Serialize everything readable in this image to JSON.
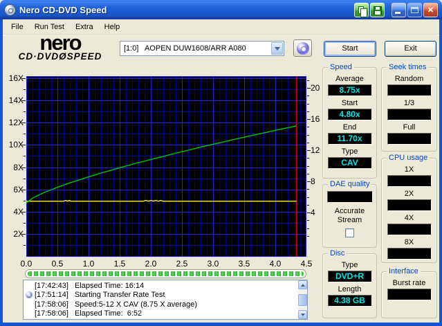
{
  "window": {
    "title": "Nero CD-DVD Speed"
  },
  "titlebar_buttons": {
    "copy": "copy",
    "save": "save",
    "minimize": "minimize",
    "maximize": "maximize",
    "close": "close"
  },
  "menu": {
    "items": [
      "File",
      "Run Test",
      "Extra",
      "Help"
    ]
  },
  "logo": {
    "line1": "nero",
    "line2": "CD·DVDØSPEED"
  },
  "toolbar": {
    "drive_value": "[1:0]   AOPEN DUW1608/ARR A080",
    "start_label": "Start",
    "exit_label": "Exit"
  },
  "chart_data": {
    "type": "line",
    "title": "",
    "xlabel": "",
    "ylabel": "",
    "x_axis": {
      "min": 0,
      "max": 4.5,
      "tick_step": 0.5,
      "tick_labels": [
        "0.0",
        "0.5",
        "1.0",
        "1.5",
        "2.0",
        "2.5",
        "3.0",
        "3.5",
        "4.0",
        "4.5"
      ]
    },
    "y_axis_left": {
      "min": 0,
      "max": 16.15,
      "tick_values": [
        16,
        14,
        12,
        10,
        8,
        6,
        4,
        2
      ],
      "tick_labels": [
        "16X",
        "14X",
        "12X",
        "10X",
        "8X",
        "6X",
        "4X",
        "2X"
      ]
    },
    "y_axis_right": {
      "tick_values": [
        20,
        16,
        12,
        8,
        4
      ],
      "tick_labels": [
        "20",
        "16",
        "12",
        "8",
        "4"
      ]
    },
    "grid": {
      "bg": "#000000",
      "major_color": "#2222DD",
      "minor_color": "#000090"
    },
    "series": [
      {
        "name": "requested-speed",
        "color": "#FFFF00",
        "points": [
          [
            0,
            4.95
          ],
          [
            0.6,
            4.95
          ],
          [
            0.63,
            5.02
          ],
          [
            0.66,
            4.95
          ],
          [
            0.69,
            5.02
          ],
          [
            0.72,
            4.95
          ],
          [
            1.88,
            4.95
          ],
          [
            1.92,
            5.02
          ],
          [
            1.96,
            4.95
          ],
          [
            2.0,
            5.02
          ],
          [
            2.04,
            4.95
          ],
          [
            2.08,
            5.02
          ],
          [
            2.12,
            4.95
          ],
          [
            2.16,
            5.02
          ],
          [
            2.2,
            4.95
          ],
          [
            4.34,
            4.95
          ]
        ]
      },
      {
        "name": "transfer-rate",
        "color": "#00C400",
        "points": [
          [
            0,
            4.8
          ],
          [
            0.1,
            5.22
          ],
          [
            0.2,
            5.51
          ],
          [
            0.3,
            5.76
          ],
          [
            0.4,
            5.98
          ],
          [
            0.5,
            6.19
          ],
          [
            0.6,
            6.4
          ],
          [
            0.7,
            6.59
          ],
          [
            0.8,
            6.77
          ],
          [
            0.9,
            6.95
          ],
          [
            1.0,
            7.13
          ],
          [
            1.2,
            7.47
          ],
          [
            1.4,
            7.79
          ],
          [
            1.6,
            8.1
          ],
          [
            1.8,
            8.4
          ],
          [
            2.0,
            8.69
          ],
          [
            2.2,
            8.97
          ],
          [
            2.4,
            9.25
          ],
          [
            2.6,
            9.52
          ],
          [
            2.8,
            9.79
          ],
          [
            3.0,
            10.05
          ],
          [
            3.2,
            10.31
          ],
          [
            3.4,
            10.56
          ],
          [
            3.6,
            10.81
          ],
          [
            3.8,
            11.05
          ],
          [
            4.0,
            11.3
          ],
          [
            4.2,
            11.53
          ],
          [
            4.34,
            11.7
          ]
        ]
      }
    ],
    "markers": [
      {
        "type": "vline",
        "x": 4.34,
        "color": "#D40000"
      }
    ]
  },
  "panels": {
    "speed": {
      "title": "Speed",
      "fields": [
        {
          "label": "Average",
          "value": "8.75x"
        },
        {
          "label": "Start",
          "value": "4.80x"
        },
        {
          "label": "End",
          "value": "11.70x"
        },
        {
          "label": "Type",
          "value": "CAV"
        }
      ]
    },
    "seek_times": {
      "title": "Seek times",
      "fields": [
        {
          "label": "Random",
          "value": ""
        },
        {
          "label": "1/3",
          "value": ""
        },
        {
          "label": "Full",
          "value": ""
        }
      ]
    },
    "dae": {
      "title": "DAE quality",
      "value": "",
      "checkbox_label": "Accurate Stream",
      "checked": false
    },
    "cpu": {
      "title": "CPU usage",
      "fields": [
        {
          "label": "1X",
          "value": ""
        },
        {
          "label": "2X",
          "value": ""
        },
        {
          "label": "4X",
          "value": ""
        },
        {
          "label": "8X",
          "value": ""
        }
      ]
    },
    "disc": {
      "title": "Disc",
      "fields": [
        {
          "label": "Type",
          "value": "DVD+R"
        },
        {
          "label": "Length",
          "value": "4.38 GB"
        }
      ]
    },
    "interface": {
      "title": "Interface",
      "fields": [
        {
          "label": "Burst rate",
          "value": ""
        }
      ]
    }
  },
  "log": {
    "lines": [
      {
        "icon": false,
        "time": "[17:42:43]",
        "text": "Elapsed Time: 16:14"
      },
      {
        "icon": true,
        "time": "[17:51:14]",
        "text": "Starting Transfer Rate Test"
      },
      {
        "icon": false,
        "time": "[17:58:06]",
        "text": "Speed:5-12 X CAV (8.75 X average)"
      },
      {
        "icon": false,
        "time": "[17:58:06]",
        "text": "Elapsed Time:  6:52"
      }
    ]
  },
  "colors": {
    "window_bg": "#ECE9D8",
    "titlebar_blue": "#1C5CD4",
    "panel_title_blue": "#0046D5",
    "value_cyan": "#00E5E5",
    "curve_green": "#00C400",
    "line_yellow": "#FFFF00",
    "marker_red": "#D40000",
    "progress_green": "#35B835"
  }
}
